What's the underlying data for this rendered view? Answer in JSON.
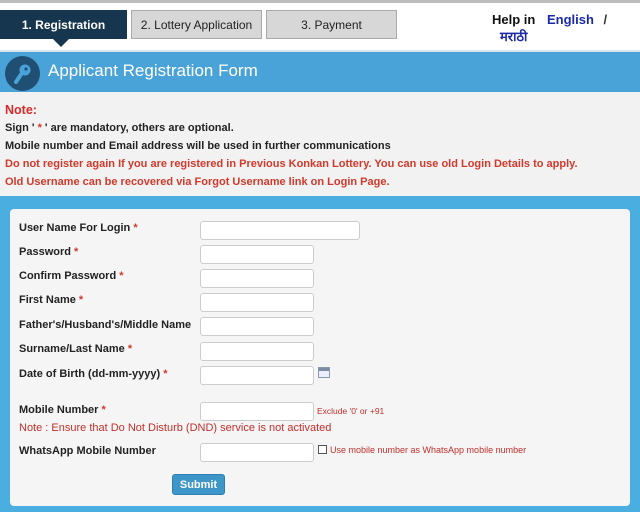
{
  "tabs": [
    {
      "label": "1. Registration",
      "active": true
    },
    {
      "label": "2. Lottery Application"
    },
    {
      "label": "3. Payment"
    }
  ],
  "help": {
    "prefix": "Help in",
    "english": "English",
    "separator": "/",
    "marathi": "मराठी"
  },
  "header": {
    "title": "Applicant Registration Form",
    "icon": "key-icon"
  },
  "notes": {
    "heading": "Note:",
    "sign_prefix": "Sign ' ",
    "sign_star": "*",
    "sign_suffix": " ' are mandatory, others are optional.",
    "line2": "Mobile number and Email address will be used in further communications",
    "line3": "Do not register again If you are registered in Previous Konkan Lottery. You can use old Login Details to apply.",
    "line4": "Old Username can be recovered via Forgot Username link on Login Page."
  },
  "form": {
    "star": "*",
    "fields": [
      {
        "label": "User Name For Login",
        "value": ""
      },
      {
        "label": "Password",
        "value": ""
      },
      {
        "label": "Confirm Password",
        "value": ""
      },
      {
        "label": "First Name",
        "value": ""
      },
      {
        "label": "Father's/Husband's/Middle Name",
        "value": ""
      },
      {
        "label": "Surname/Last Name",
        "value": ""
      },
      {
        "label": "Date of Birth (dd-mm-yyyy)",
        "value": ""
      },
      {
        "label": "Mobile Number",
        "value": ""
      },
      {
        "label": "WhatsApp Mobile Number",
        "value": ""
      }
    ],
    "mobile_hint": "Exclude '0' or +91",
    "dnd_note": "Note : Ensure that Do Not Disturb (DND) service is not activated",
    "whatsapp_checkbox": "Use mobile number as WhatsApp mobile number",
    "whatsapp_checked": false,
    "submit": "Submit"
  },
  "colors": {
    "accent": "#4aa3d8",
    "tab_active": "#163650",
    "required": "#d0392b"
  }
}
